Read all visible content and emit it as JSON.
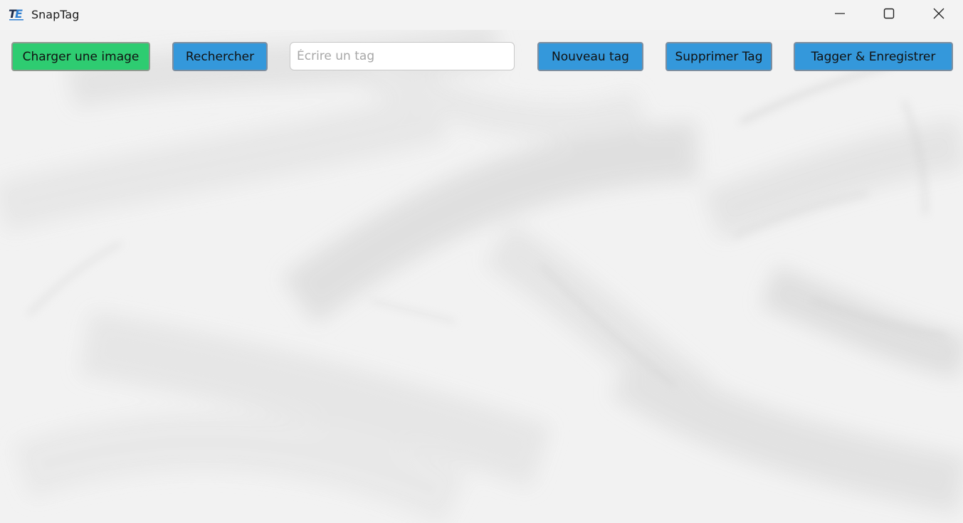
{
  "window": {
    "title": "SnapTag",
    "icon": "snaptag-logo-icon",
    "controls": {
      "minimize": "minimize-icon",
      "maximize": "maximize-icon",
      "close": "close-icon"
    }
  },
  "toolbar": {
    "load_image_label": "Charger une image",
    "search_label": "Rechercher",
    "tag_input": {
      "value": "",
      "placeholder": "Écrire un tag"
    },
    "new_tag_label": "Nouveau tag",
    "delete_tag_label": "Supprimer Tag",
    "tag_save_label": "Tagger & Enregistrer"
  },
  "colors": {
    "green_button": "#2ecc71",
    "blue_button": "#3498db",
    "titlebar": "#f3f3f3",
    "background": "#f2f2f2"
  }
}
